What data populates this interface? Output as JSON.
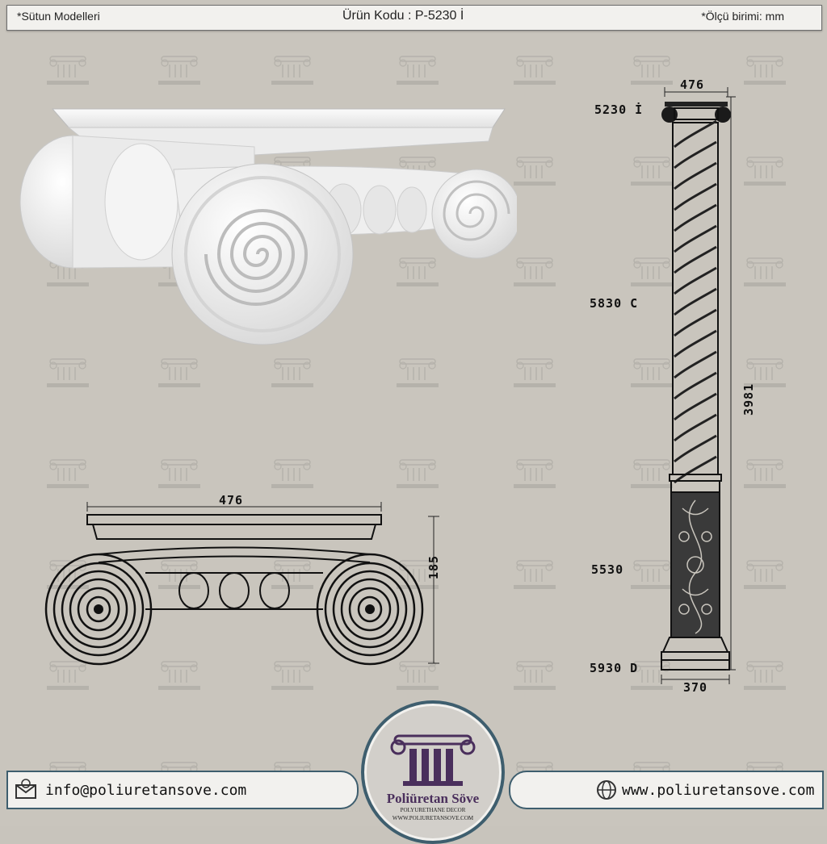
{
  "header": {
    "left": "*Sütun  Modelleri",
    "center": "Ürün Kodu : P-5230 İ",
    "right": "*Ölçü birimi: mm"
  },
  "drawing": {
    "width_label": "476",
    "height_label": "185"
  },
  "column": {
    "label_capital": "5230 İ",
    "label_shaft": "5830 C",
    "label_base_decor": "5530",
    "label_plinth": "5930 D",
    "top_width": "476",
    "total_height": "3981",
    "bottom_width": "370"
  },
  "footer": {
    "email": "info@poliuretansove.com",
    "website": "www.poliuretansove.com"
  },
  "logo": {
    "brand": "Poliüretan Söve",
    "tagline": "POLYURETHANE DECOR",
    "url": "WWW.POLIURETANSOVE.COM"
  },
  "colors": {
    "background": "#c9c5bd",
    "bar": "#f2f1ee",
    "accent": "#3e5e6e",
    "logo_purple": "#4a2f5c"
  }
}
